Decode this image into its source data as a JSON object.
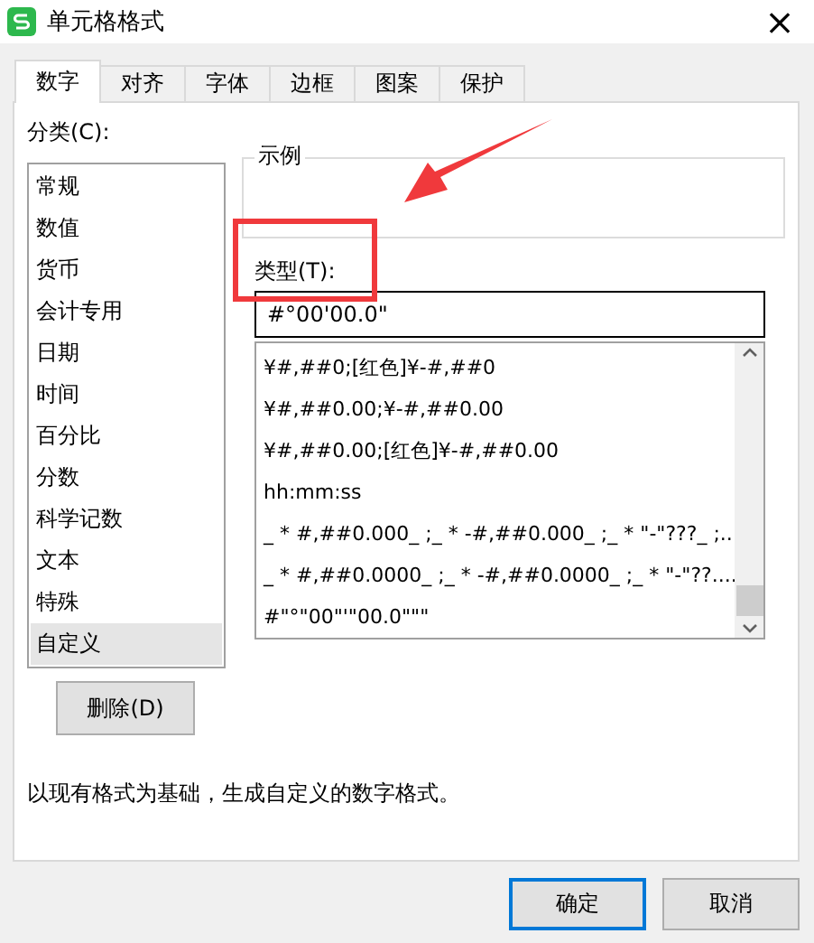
{
  "window": {
    "title": "单元格格式",
    "close": "×"
  },
  "tabs": [
    {
      "label": "数字",
      "selected": true
    },
    {
      "label": "对齐",
      "selected": false
    },
    {
      "label": "字体",
      "selected": false
    },
    {
      "label": "边框",
      "selected": false
    },
    {
      "label": "图案",
      "selected": false
    },
    {
      "label": "保护",
      "selected": false
    }
  ],
  "category": {
    "label": "分类(C):",
    "items": [
      {
        "label": "常规",
        "selected": false
      },
      {
        "label": "数值",
        "selected": false
      },
      {
        "label": "货币",
        "selected": false
      },
      {
        "label": "会计专用",
        "selected": false
      },
      {
        "label": "日期",
        "selected": false
      },
      {
        "label": "时间",
        "selected": false
      },
      {
        "label": "百分比",
        "selected": false
      },
      {
        "label": "分数",
        "selected": false
      },
      {
        "label": "科学记数",
        "selected": false
      },
      {
        "label": "文本",
        "selected": false
      },
      {
        "label": "特殊",
        "selected": false
      },
      {
        "label": "自定义",
        "selected": true
      }
    ]
  },
  "delete_button": "删除(D)",
  "sample": {
    "label": "示例"
  },
  "type": {
    "label": "类型(T):",
    "value": "#°00'00.0\""
  },
  "formats": [
    {
      "label": "¥#,##0;[红色]¥-#,##0"
    },
    {
      "label": "¥#,##0.00;¥-#,##0.00"
    },
    {
      "label": "¥#,##0.00;[红色]¥-#,##0.00"
    },
    {
      "label": "hh:mm:ss"
    },
    {
      "label": "_ * #,##0.000_ ;_ * -#,##0.000_ ;_ * \"-\"???_ ;..."
    },
    {
      "label": "_ * #,##0.0000_ ;_ * -#,##0.0000_ ;_ * \"-\"??...."
    },
    {
      "label": "#\"°\"00\"'\"00.0\"\"\""
    }
  ],
  "description": "以现有格式为基础，生成自定义的数字格式。",
  "buttons": [
    {
      "label": "确定",
      "selected": true
    },
    {
      "label": "取消",
      "selected": false
    }
  ]
}
